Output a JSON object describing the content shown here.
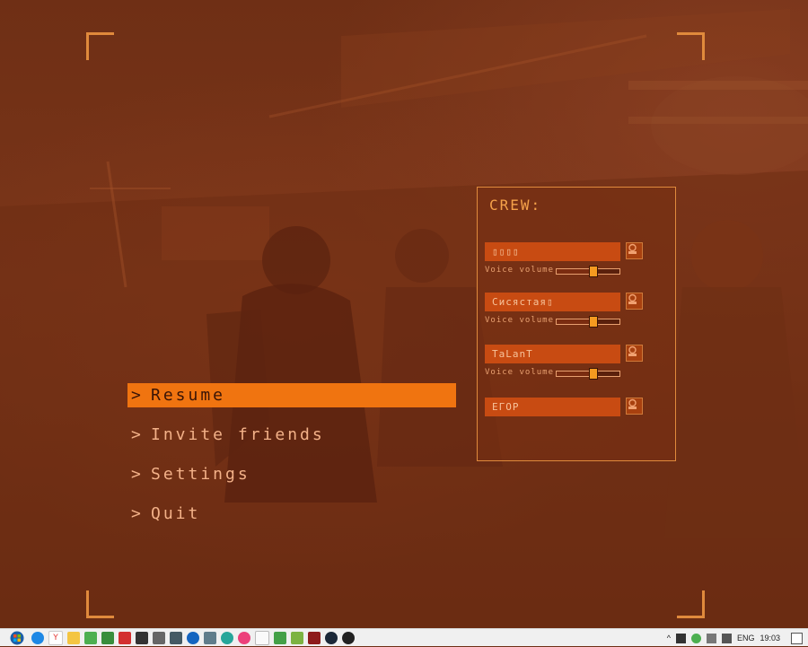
{
  "menu": {
    "items": [
      {
        "label": "Resume",
        "active": true
      },
      {
        "label": "Invite friends",
        "active": false
      },
      {
        "label": "Settings",
        "active": false
      },
      {
        "label": "Quit",
        "active": false
      }
    ],
    "chevron": ">"
  },
  "crew": {
    "title": "CREW:",
    "players": [
      {
        "name": "▯▯▯▯",
        "voice_label": "Voice volume",
        "volume": 0.58
      },
      {
        "name": "Сисястая▯",
        "voice_label": "Voice volume",
        "volume": 0.58
      },
      {
        "name": "TaLanT",
        "voice_label": "Voice volume",
        "volume": 0.58
      },
      {
        "name": "ЕГОР"
      }
    ]
  },
  "taskbar": {
    "language": "ENG",
    "time": "19:03",
    "tray_chevron": "^"
  },
  "colors": {
    "accent": "#f07410",
    "frame": "#e08a3c",
    "name_bar": "#c84b12",
    "background": "#6e2e14"
  }
}
